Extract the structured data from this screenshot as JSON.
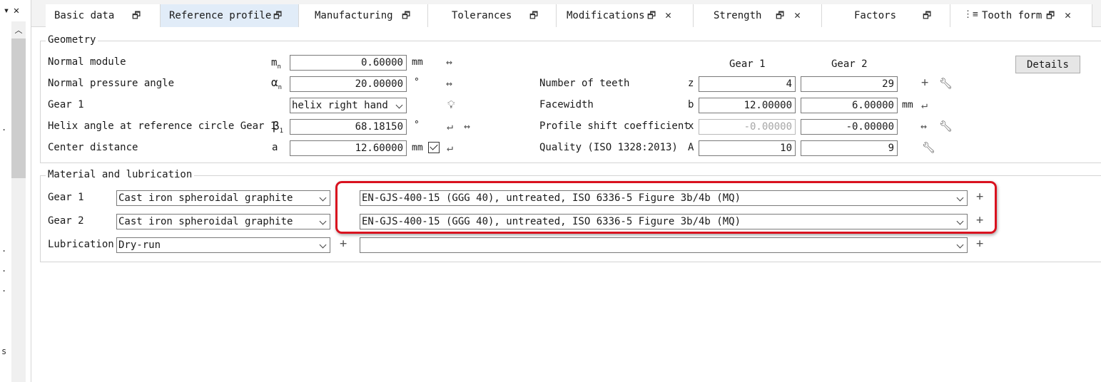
{
  "tabs": [
    {
      "label": "Basic data",
      "icon": "restore-window-icon",
      "closable": false
    },
    {
      "label": "Reference profile",
      "icon": "restore-window-icon",
      "closable": false
    },
    {
      "label": "Manufacturing",
      "icon": "restore-window-icon",
      "closable": false
    },
    {
      "label": "Tolerances",
      "icon": "restore-window-icon",
      "closable": false
    },
    {
      "label": "Modifications",
      "icon": "restore-window-icon",
      "closable": true
    },
    {
      "label": "Strength",
      "icon": "restore-window-icon",
      "closable": true
    },
    {
      "label": "Factors",
      "icon": "restore-window-icon",
      "closable": false
    },
    {
      "label": "Tooth form",
      "icon": "restore-window-icon",
      "closable": true
    }
  ],
  "geometry": {
    "title": "Geometry",
    "normal_module": {
      "label": "Normal module",
      "symbol": "m",
      "sub": "n",
      "value": "0.60000",
      "unit": "mm"
    },
    "pressure_angle": {
      "label": "Normal pressure angle",
      "symbol": "α",
      "sub": "n",
      "value": "20.00000",
      "unit": "°"
    },
    "gear1_helix": {
      "label": "Gear 1",
      "value": "helix right hand"
    },
    "helix_angle": {
      "label": "Helix angle at reference circle Gear 1",
      "symbol": "β",
      "sub": "1",
      "value": "68.18150",
      "unit": "°"
    },
    "center_distance": {
      "label": "Center distance",
      "symbol": "a",
      "value": "12.60000",
      "unit": "mm",
      "checked": true
    },
    "col_gear1": "Gear 1",
    "col_gear2": "Gear 2",
    "details": "Details",
    "teeth": {
      "label": "Number of teeth",
      "symbol": "z",
      "g1": "4",
      "g2": "29"
    },
    "facewidth": {
      "label": "Facewidth",
      "symbol": "b",
      "g1": "12.00000",
      "g2": "6.00000",
      "unit": "mm"
    },
    "shift": {
      "label": "Profile shift coefficient",
      "symbol": "x",
      "g1": "-0.00000",
      "g2": "-0.00000"
    },
    "quality": {
      "label": "Quality (ISO 1328:2013)",
      "symbol": "A",
      "g1": "10",
      "g2": "9"
    }
  },
  "material": {
    "title": "Material and lubrication",
    "gear1": {
      "label": "Gear 1",
      "type": "Cast iron spheroidal graphite",
      "material": "EN-GJS-400-15 (GGG 40), untreated, ISO 6336-5 Figure 3b/4b (MQ)"
    },
    "gear2": {
      "label": "Gear 2",
      "type": "Cast iron spheroidal graphite",
      "material": "EN-GJS-400-15 (GGG 40), untreated, ISO 6336-5 Figure 3b/4b (MQ)"
    },
    "lubrication": {
      "label": "Lubrication",
      "type": "Dry-run",
      "value": ""
    }
  },
  "highlight_color": "#d9121f",
  "left_strip": {
    "close": "✕",
    "marks": [
      ".",
      ".",
      ".",
      ".",
      "s"
    ]
  }
}
